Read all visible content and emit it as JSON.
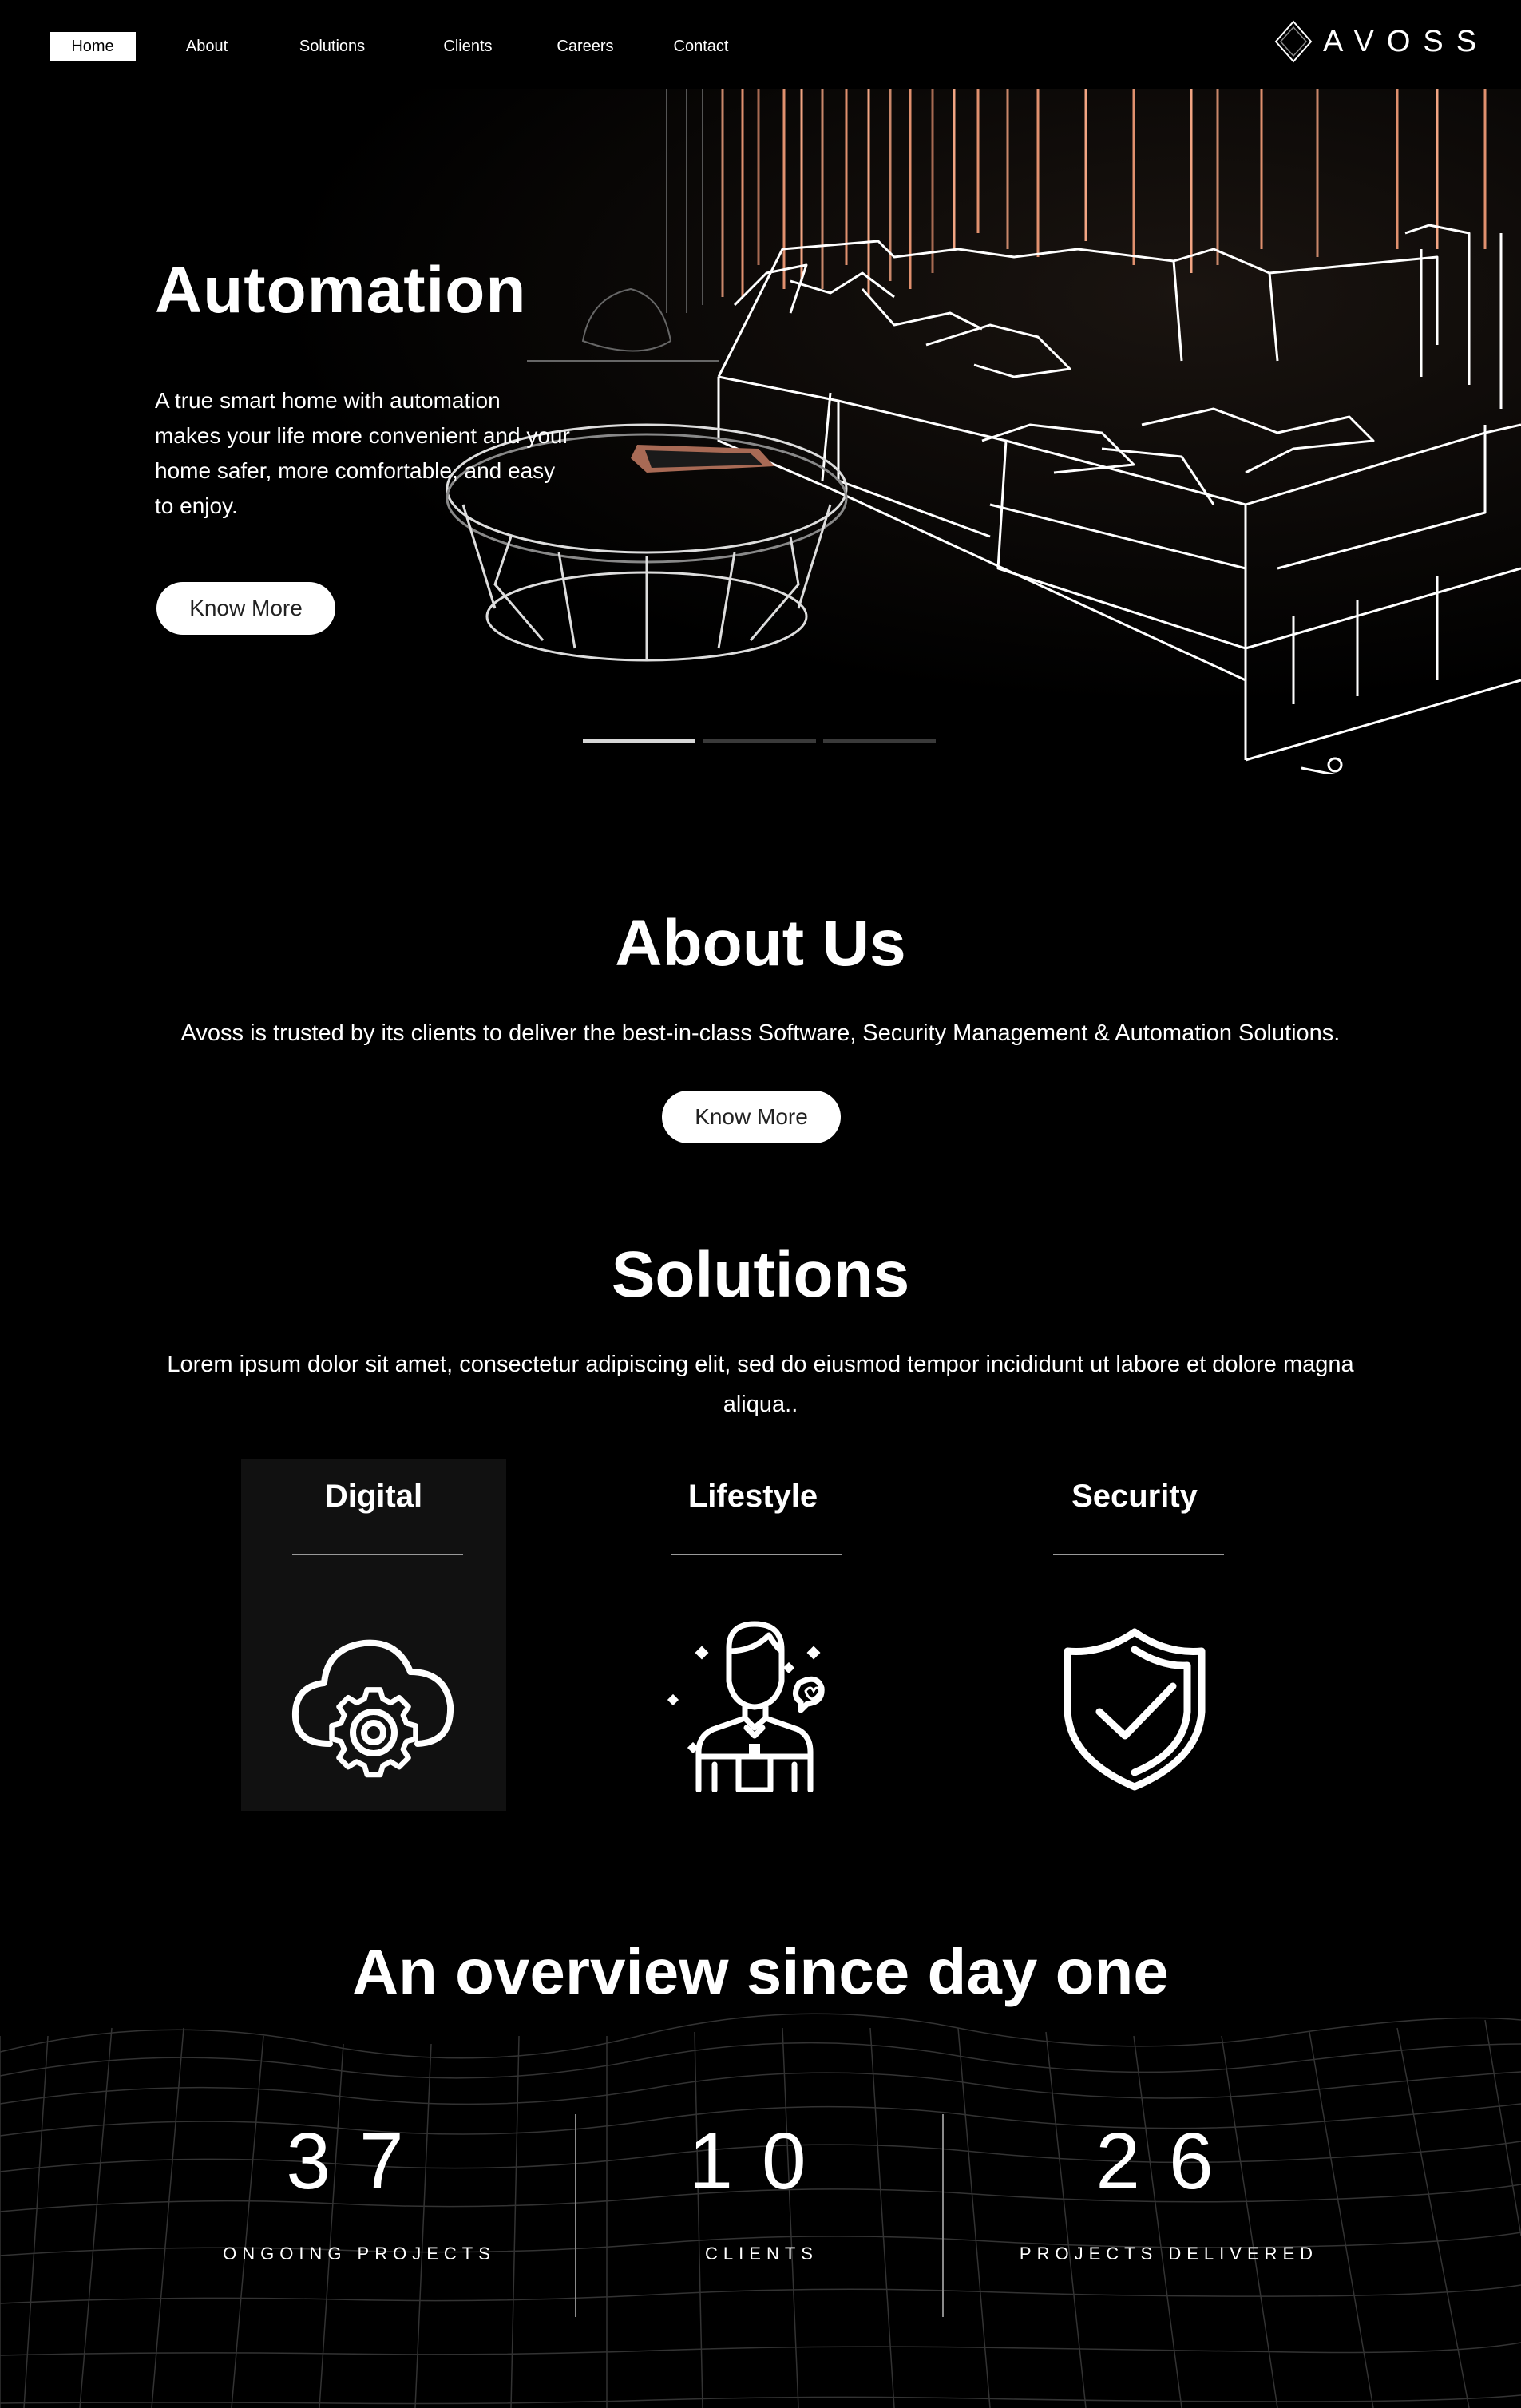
{
  "nav": {
    "items": [
      {
        "label": "Home",
        "active": true
      },
      {
        "label": "About"
      },
      {
        "label": "Solutions"
      },
      {
        "label": "Clients"
      },
      {
        "label": "Careers"
      },
      {
        "label": "Contact"
      }
    ],
    "logo_text": "AVOSS"
  },
  "hero": {
    "title": "Automation",
    "text": "A true smart home with automation makes your life more convenient and your home safer, more comfortable, and easy to enjoy.",
    "button": "Know More",
    "slides": 3,
    "active_slide": 0,
    "accent_color": "#e0906e"
  },
  "about": {
    "title": "About Us",
    "text": "Avoss is trusted by its clients to deliver the best-in-class Software, Security Management & Automation Solutions.",
    "button": "Know More"
  },
  "solutions": {
    "title": "Solutions",
    "text": "Lorem ipsum dolor sit amet, consectetur adipiscing elit, sed do eiusmod tempor incididunt ut labore et dolore magna aliqua..",
    "cards": [
      {
        "title": "Digital",
        "icon": "cloud-gear-icon",
        "active": true
      },
      {
        "title": "Lifestyle",
        "icon": "person-icon"
      },
      {
        "title": "Security",
        "icon": "shield-check-icon"
      }
    ]
  },
  "overview": {
    "title": "An overview since day one",
    "stats": [
      {
        "value": "37",
        "label": "ONGOING PROJECTS"
      },
      {
        "value": "10",
        "label": "CLIENTS"
      },
      {
        "value": "26",
        "label": "PROJECTS DELIVERED"
      }
    ]
  }
}
